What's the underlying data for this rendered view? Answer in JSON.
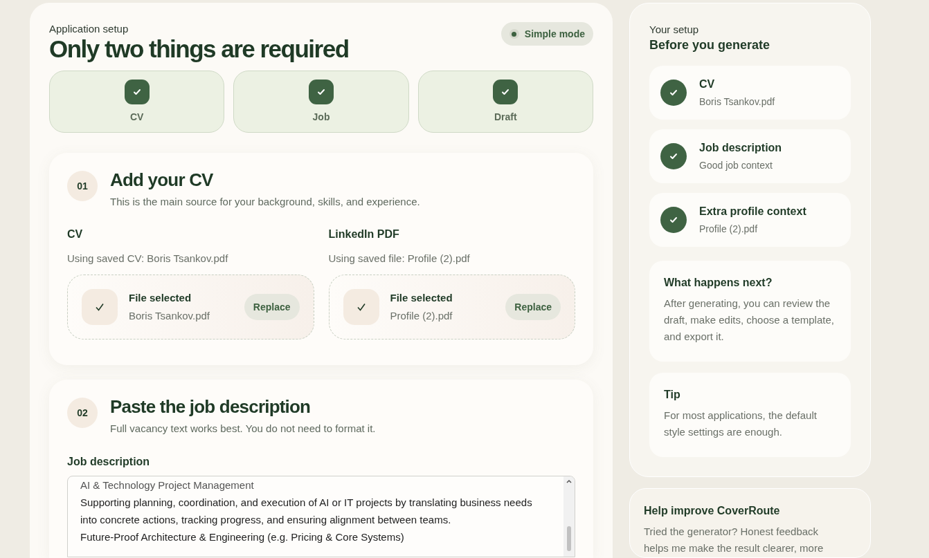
{
  "header": {
    "eyebrow": "Application setup",
    "title": "Only two things are required",
    "mode_pill": {
      "label": "Simple mode",
      "on": true
    }
  },
  "steps": [
    {
      "label": "CV",
      "done": true
    },
    {
      "label": "Job",
      "done": true
    },
    {
      "label": "Draft",
      "done": true
    }
  ],
  "section_cv": {
    "number": "01",
    "title": "Add your CV",
    "subtitle": "This is the main source for your background, skills, and experience.",
    "uploads": [
      {
        "label": "CV",
        "note": "Using saved CV: Boris Tsankov.pdf",
        "status": "File selected",
        "file": "Boris Tsankov.pdf",
        "button": "Replace"
      },
      {
        "label": "LinkedIn PDF",
        "note": "Using saved file: Profile (2).pdf",
        "status": "File selected",
        "file": "Profile (2).pdf",
        "button": "Replace"
      }
    ]
  },
  "section_job": {
    "number": "02",
    "title": "Paste the job description",
    "subtitle": "Full vacancy text works best. You do not need to format it.",
    "field_label": "Job description",
    "field_lines": [
      "AI & Technology Project Management",
      "Supporting planning, coordination, and execution of AI or IT projects by translating business needs into concrete actions, tracking progress, and ensuring alignment between teams.",
      "Future-Proof Architecture & Engineering (e.g. Pricing & Core Systems)"
    ]
  },
  "sidebar": {
    "eyebrow": "Your setup",
    "title": "Before you generate",
    "checklist": [
      {
        "title": "CV",
        "detail": "Boris Tsankov.pdf",
        "done": true
      },
      {
        "title": "Job description",
        "detail": "Good job context",
        "done": true
      },
      {
        "title": "Extra profile context",
        "detail": "Profile (2).pdf",
        "done": true
      }
    ],
    "info_cards": [
      {
        "title": "What happens next?",
        "text": "After generating, you can review the draft, make edits, choose a template, and export it."
      },
      {
        "title": "Tip",
        "text": "For most applications, the default style settings are enough."
      }
    ]
  },
  "feedback": {
    "title": "Help improve CoverRoute",
    "text": "Tried the generator? Honest feedback helps me make the result clearer, more"
  }
}
